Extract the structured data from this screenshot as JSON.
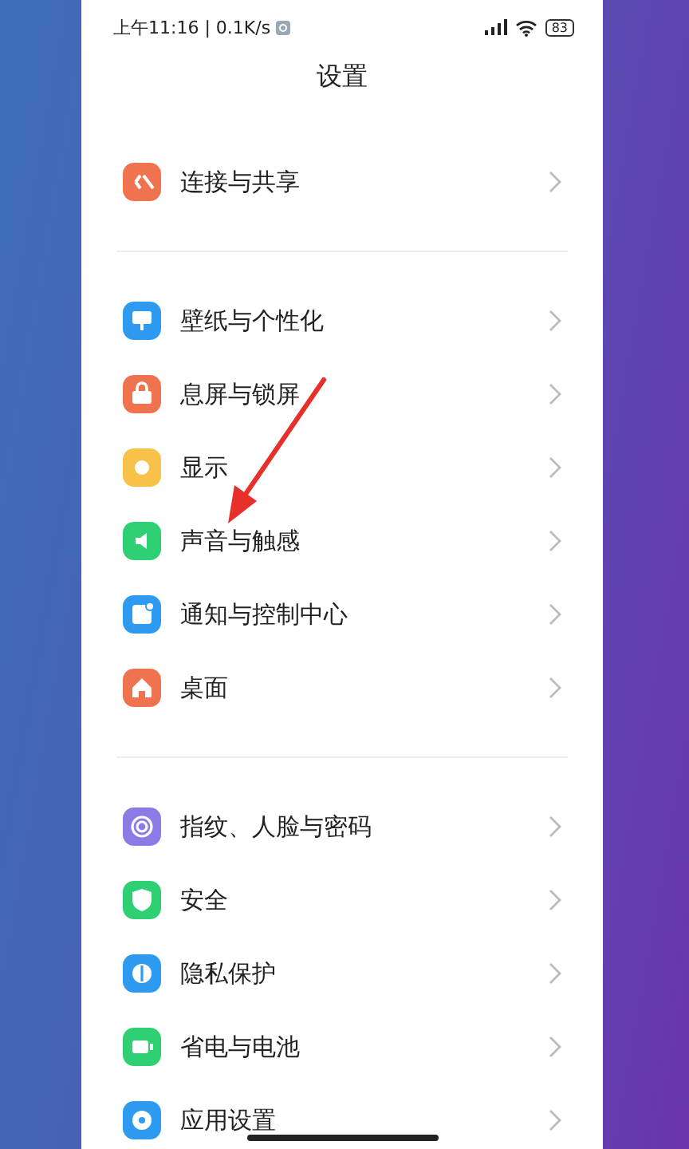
{
  "status_bar": {
    "time": "上午11:16 | 0.1K/s",
    "battery": "83"
  },
  "title": "设置",
  "groups": [
    {
      "items": [
        {
          "label": "连接与共享",
          "color": "#f0734f"
        }
      ]
    },
    {
      "items": [
        {
          "label": "壁纸与个性化",
          "color": "#2f9bf0"
        },
        {
          "label": "息屏与锁屏",
          "color": "#f0734f"
        },
        {
          "label": "显示",
          "color": "#f8c14a"
        },
        {
          "label": "声音与触感",
          "color": "#2fcf73"
        },
        {
          "label": "通知与控制中心",
          "color": "#2f9bf0"
        },
        {
          "label": "桌面",
          "color": "#f0734f"
        }
      ]
    },
    {
      "items": [
        {
          "label": "指纹、人脸与密码",
          "color": "#8a7be6"
        },
        {
          "label": "安全",
          "color": "#2fcf73"
        },
        {
          "label": "隐私保护",
          "color": "#2f9bf0"
        },
        {
          "label": "省电与电池",
          "color": "#2fcf73"
        },
        {
          "label": "应用设置",
          "color": "#2f9bf0"
        }
      ]
    }
  ]
}
